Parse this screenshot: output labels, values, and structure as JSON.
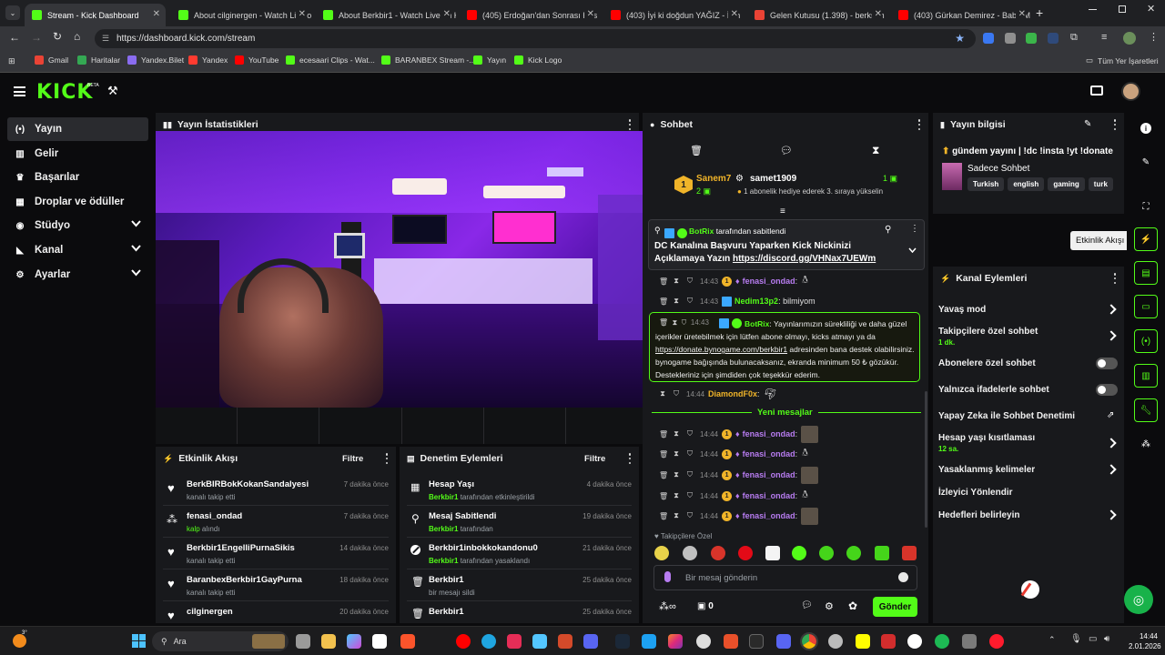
{
  "browser": {
    "tabs": [
      {
        "title": "Stream - Kick Dashboard",
        "color": "#53fc18"
      },
      {
        "title": "About cilginergen - Watch Live on",
        "color": "#53fc18"
      },
      {
        "title": "About Berkbir1 - Watch Live on Ki",
        "color": "#53fc18"
      },
      {
        "title": "(405) Erdoğan'dan Sonrası Hes",
        "color": "#ff0000"
      },
      {
        "title": "(403) İyi ki doğdun YAĞIZ - İsm",
        "color": "#ff0000"
      },
      {
        "title": "Gelen Kutusu (1.398) - berksun",
        "color": "#ea4335"
      },
      {
        "title": "(403) Gürkan Demirez - Baba M",
        "color": "#ff0000"
      }
    ],
    "url": "https://dashboard.kick.com/stream",
    "bookmarks": [
      {
        "label": "Gmail",
        "color": "#ea4335"
      },
      {
        "label": "Haritalar",
        "color": "#34a853"
      },
      {
        "label": "Yandex.Bilet",
        "color": "#8a6cf0"
      },
      {
        "label": "Yandex",
        "color": "#ff3b30"
      },
      {
        "label": "YouTube",
        "color": "#ff0000"
      },
      {
        "label": "ecesaari Clips - Wat...",
        "color": "#53fc18"
      },
      {
        "label": "BARANBEX Stream -...",
        "color": "#53fc18"
      },
      {
        "label": "Yayın",
        "color": "#53fc18"
      },
      {
        "label": "Kick Logo",
        "color": "#53fc18"
      }
    ],
    "all_bookmarks": "Tüm Yer İşaretleri"
  },
  "app": {
    "logo": "KICK",
    "logo_beta": "BETA",
    "accent": "#53fc18"
  },
  "sidebar": {
    "items": [
      {
        "label": "Yayın",
        "icon": "broadcast-icon"
      },
      {
        "label": "Gelir",
        "icon": "bank-icon"
      },
      {
        "label": "Başarılar",
        "icon": "trophy-icon"
      },
      {
        "label": "Droplar ve ödüller",
        "icon": "gift-icon"
      },
      {
        "label": "Stüdyo",
        "icon": "studio-icon"
      },
      {
        "label": "Kanal",
        "icon": "channel-icon"
      },
      {
        "label": "Ayarlar",
        "icon": "gear-icon"
      }
    ]
  },
  "stats_panel": {
    "title": "Yayın İstatistikleri"
  },
  "activity_feed": {
    "title": "Etkinlik Akışı",
    "filter": "Filtre",
    "items": [
      {
        "user": "BerkBIRBokKokanSandalyesi",
        "action": "kanalı takip etti",
        "time": "7 dakika önce",
        "icon": "heart-icon",
        "highlight": ""
      },
      {
        "user": "fenasi_ondad",
        "action": "alındı",
        "highlight": "kalp",
        "time": "7 dakika önce",
        "icon": "kicks-icon"
      },
      {
        "user": "Berkbir1EngelliPurnaSikis",
        "action": "kanalı takip etti",
        "time": "14 dakika önce",
        "icon": "heart-icon",
        "highlight": ""
      },
      {
        "user": "BaranbexBerkbir1GayPurna",
        "action": "kanalı takip etti",
        "time": "18 dakika önce",
        "icon": "heart-icon",
        "highlight": ""
      },
      {
        "user": "cilginergen",
        "action": "",
        "time": "20 dakika önce",
        "icon": "heart-icon",
        "highlight": ""
      }
    ]
  },
  "mod_actions": {
    "title": "Denetim Eylemleri",
    "filter": "Filtre",
    "items": [
      {
        "title": "Hesap Yaşı",
        "by": "Berkbir1",
        "suffix": "tarafından etkinleştirildi",
        "time": "4 dakika önce",
        "icon": "calendar-icon"
      },
      {
        "title": "Mesaj Sabitlendi",
        "by": "Berkbir1",
        "suffix": "tarafından",
        "time": "19 dakika önce",
        "icon": "pin-icon"
      },
      {
        "title": "Berkbir1inbokkokandonu0",
        "by": "Berkbir1",
        "suffix": "tarafından yasaklandı",
        "time": "21 dakika önce",
        "icon": "ban-icon"
      },
      {
        "title": "Berkbir1",
        "by": "",
        "suffix": "bir mesajı sildi",
        "time": "25 dakika önce",
        "icon": "trash-icon"
      },
      {
        "title": "Berkbir1",
        "by": "",
        "suffix": "",
        "time": "25 dakika önce",
        "icon": "trash-icon"
      }
    ]
  },
  "chat": {
    "title": "Sohbet",
    "leaderboard": {
      "user1": "Sanem7",
      "user1_count": "2",
      "user2": "samet1909",
      "user2_count": "1",
      "rank": "1",
      "note": "1 abonelik hediye ederek 3. sıraya yükselin"
    },
    "pinned": {
      "by_user": "BotRix",
      "by_text": "tarafından sabitlendi",
      "text": "DC Kanalına Başvuru Yaparken Kick Nickinizi Açıklamaya Yazın",
      "link": "https://discord.gg/VHNax7UEWm"
    },
    "messages": [
      {
        "time": "14:43",
        "user": "fenasi_ondad",
        "text": "",
        "color": "#b77cf0",
        "sub": true,
        "emote": true
      },
      {
        "time": "14:43",
        "user": "Nedim13p2",
        "text": "bilmiyom",
        "color": "#53fc18",
        "sub": false,
        "emote": false
      }
    ],
    "botrix_msg": {
      "time": "14:43",
      "user": "BotRix",
      "text1": "Yayınlarımızın sürekliliği ve daha güzel içerikler üretebilmek için lütfen abone olmayı, kicks atmayı ya da ",
      "link": "https://donate.bynogame.com/berkbir1",
      "text2": " adresinden bana destek olabilirsiniz. bynogame bağışında bulunacaksanız, ekranda minimum 50 ₺ gözükür. Destekleriniz için şimdiden çok teşekkür ederim."
    },
    "diamond": {
      "time": "14:44",
      "user": "DiamondF0x"
    },
    "new_messages": "Yeni mesajlar",
    "messages2": [
      {
        "time": "14:44",
        "user": "fenasi_ondad"
      },
      {
        "time": "14:44",
        "user": "fenasi_ondad"
      },
      {
        "time": "14:44",
        "user": "fenasi_ondad"
      },
      {
        "time": "14:44",
        "user": "fenasi_ondad"
      },
      {
        "time": "14:44",
        "user": "fenasi_ondad"
      }
    ],
    "followers_only": "Takipçilere Özel",
    "input_placeholder": "Bir mesaj gönderin",
    "points": "0",
    "send": "Gönder"
  },
  "stream_info": {
    "title": "Yayın bilgisi",
    "stream_title": "gündem yayını | !dc !insta !yt !donate",
    "category": "Sadece Sohbet",
    "tags": [
      "Turkish",
      "english",
      "gaming",
      "turk"
    ]
  },
  "tooltip": "Etkinlik Akışı",
  "channel_actions": {
    "title": "Kanal Eylemleri",
    "items": [
      {
        "label": "Yavaş mod",
        "sub": "",
        "control": "chevron"
      },
      {
        "label": "Takipçilere özel sohbet",
        "sub": "1 dk.",
        "control": "chevron"
      },
      {
        "label": "Abonelere özel sohbet",
        "sub": "",
        "control": "toggle"
      },
      {
        "label": "Yalnızca ifadelerle sohbet",
        "sub": "",
        "control": "toggle"
      },
      {
        "label": "Yapay Zeka ile Sohbet Denetimi",
        "sub": "",
        "control": "external"
      },
      {
        "label": "Hesap yaşı kısıtlaması",
        "sub": "12 sa.",
        "control": "chevron"
      },
      {
        "label": "Yasaklanmış kelimeler",
        "sub": "",
        "control": "chevron"
      },
      {
        "label": "İzleyici Yönlendir",
        "sub": "",
        "control": "none"
      },
      {
        "label": "Hedefleri belirleyin",
        "sub": "",
        "control": "chevron"
      }
    ]
  },
  "taskbar": {
    "search": "Ara",
    "weather_badge": "3°",
    "time": "14:44",
    "date": "2.01.2026"
  }
}
